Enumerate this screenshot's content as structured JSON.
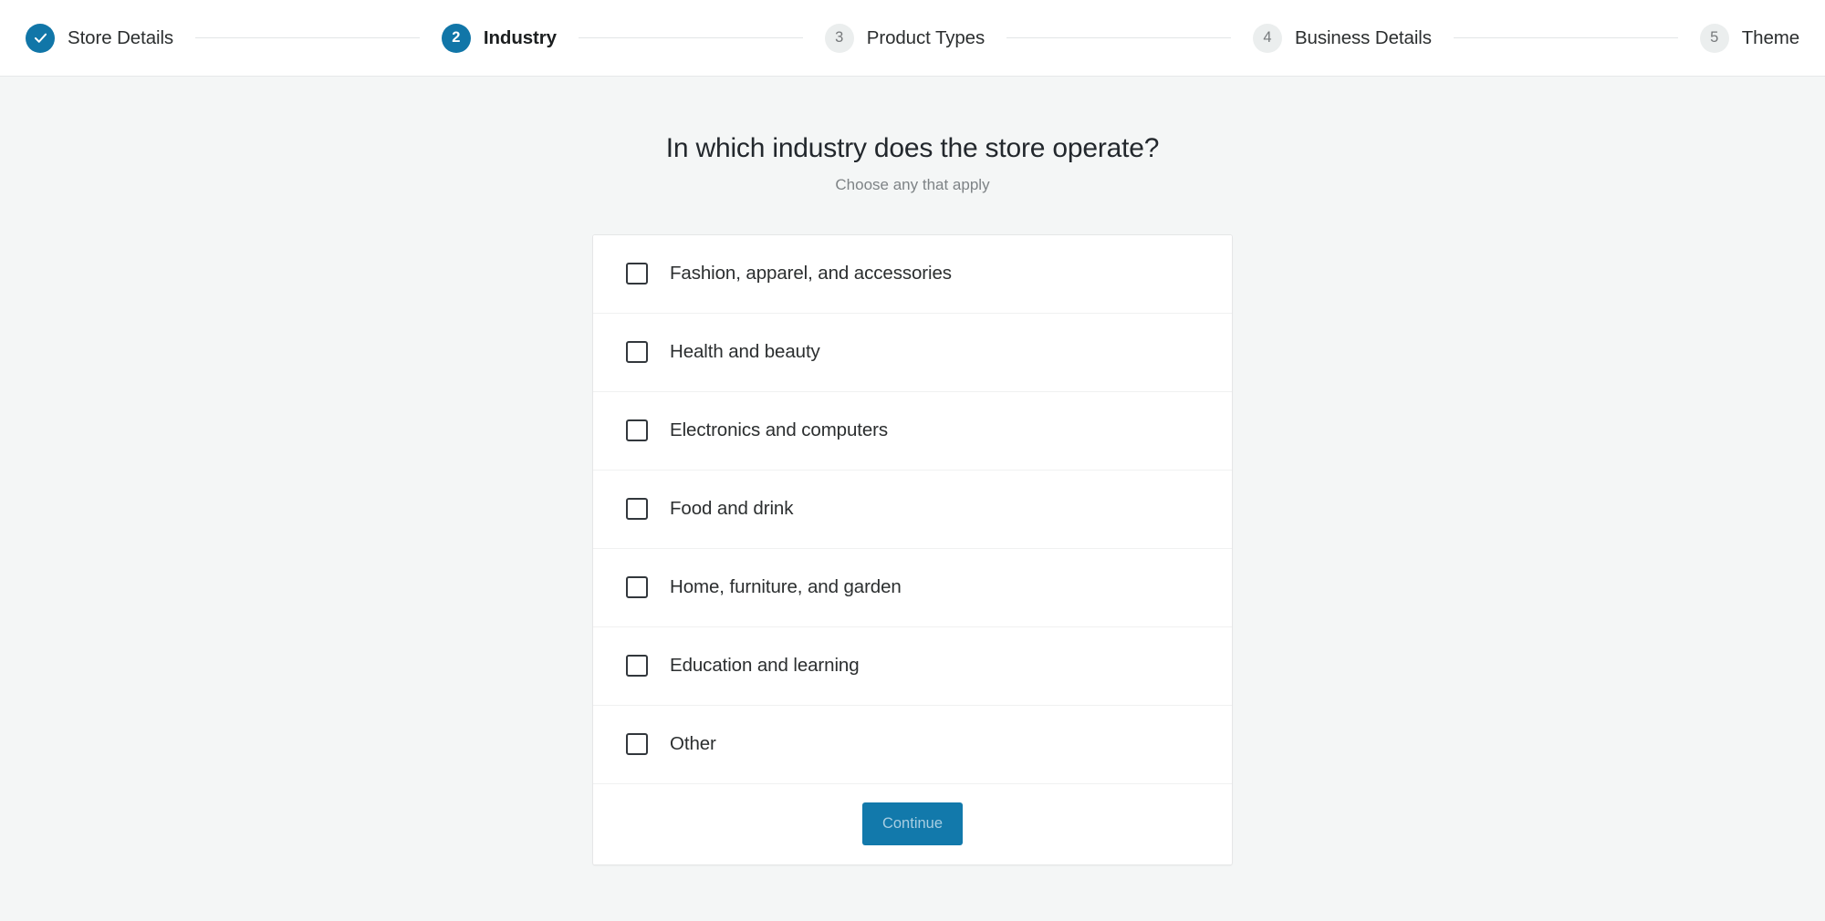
{
  "stepper": {
    "steps": [
      {
        "marker": "check-icon",
        "label": "Store Details",
        "state": "completed"
      },
      {
        "marker": "2",
        "label": "Industry",
        "state": "active"
      },
      {
        "marker": "3",
        "label": "Product Types",
        "state": "pending"
      },
      {
        "marker": "4",
        "label": "Business Details",
        "state": "pending"
      },
      {
        "marker": "5",
        "label": "Theme",
        "state": "pending"
      }
    ]
  },
  "main": {
    "title": "In which industry does the store operate?",
    "subtitle": "Choose any that apply",
    "industries": [
      {
        "label": "Fashion, apparel, and accessories",
        "checked": false
      },
      {
        "label": "Health and beauty",
        "checked": false
      },
      {
        "label": "Electronics and computers",
        "checked": false
      },
      {
        "label": "Food and drink",
        "checked": false
      },
      {
        "label": "Home, furniture, and garden",
        "checked": false
      },
      {
        "label": "Education and learning",
        "checked": false
      },
      {
        "label": "Other",
        "checked": false
      }
    ],
    "continue_label": "Continue"
  },
  "colors": {
    "accent": "#1176a8",
    "page_background": "#f4f6f6",
    "card_background": "#ffffff",
    "button_background": "#1279ab",
    "button_text": "#a8cee2"
  }
}
